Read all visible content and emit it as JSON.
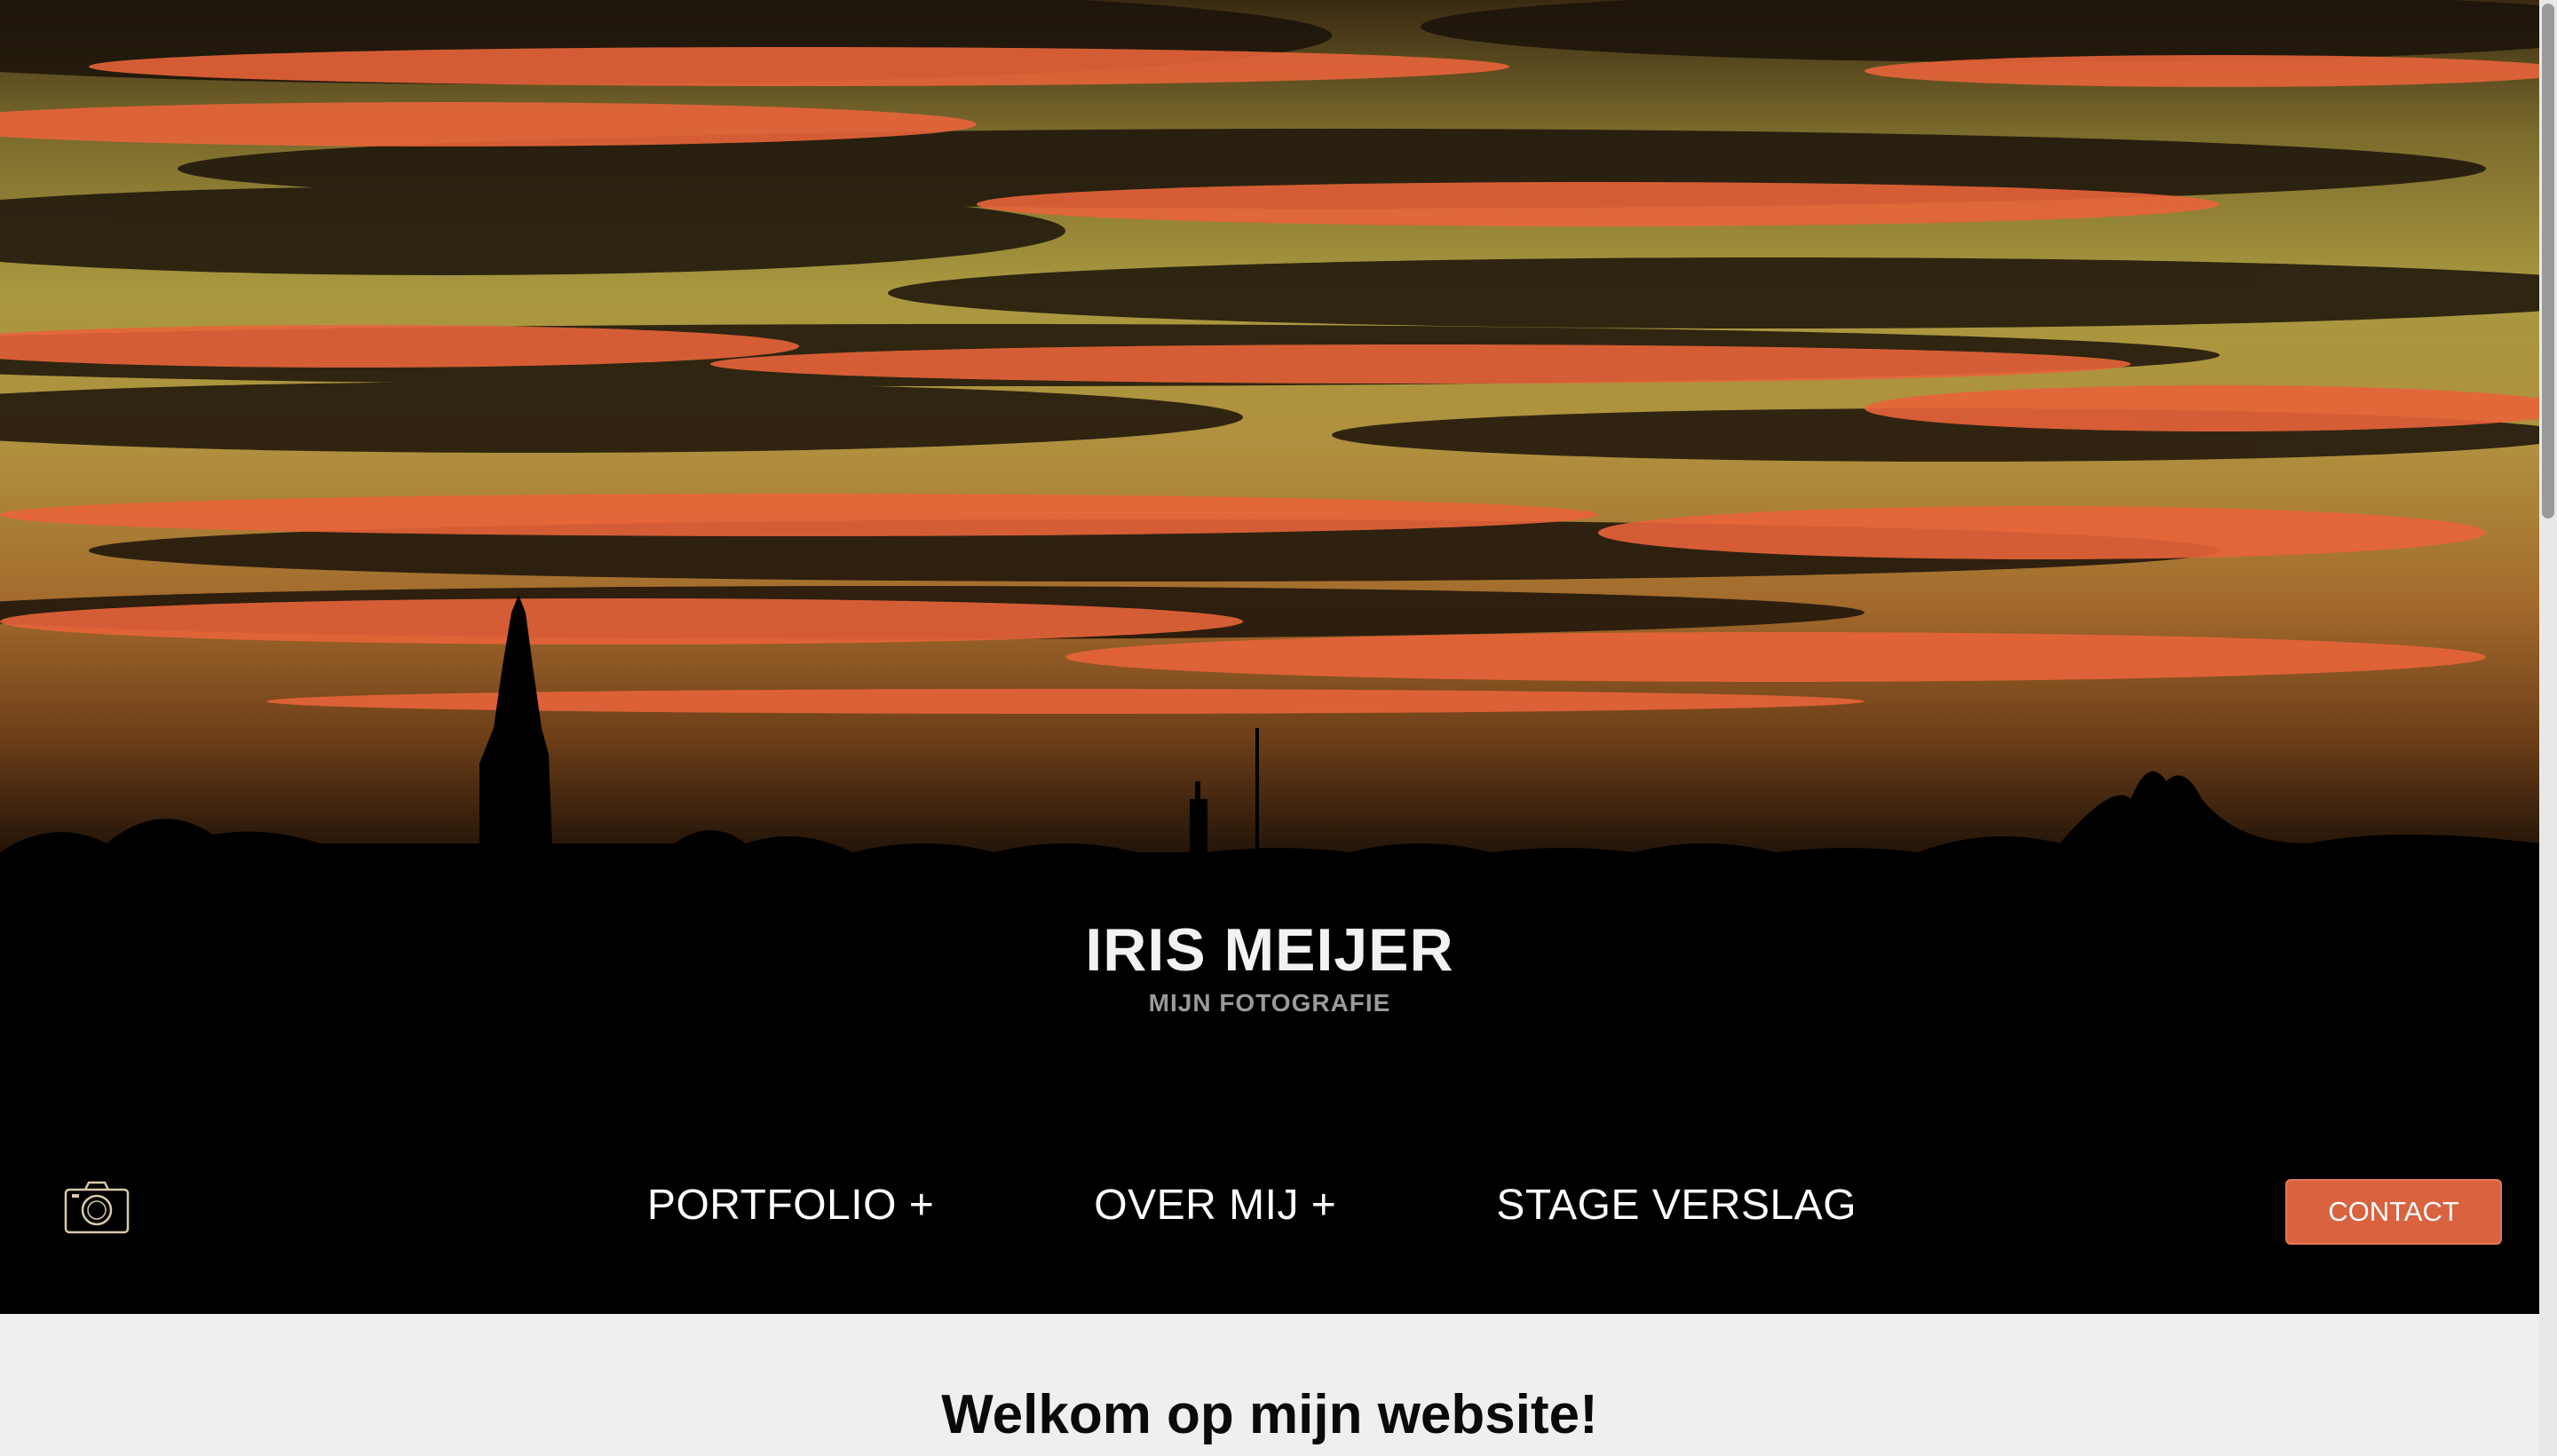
{
  "hero": {
    "title": "IRIS MEIJER",
    "subtitle": "MIJN FOTOGRAFIE",
    "image_description_icon": "sunset-church-silhouette"
  },
  "navbar": {
    "logo_icon": "camera-icon",
    "links": [
      {
        "label": "PORTFOLIO +"
      },
      {
        "label": "OVER MIJ +"
      },
      {
        "label": "STAGE VERSLAG"
      }
    ],
    "contact_label": "CONTACT"
  },
  "main": {
    "heading": "Welkom op mijn website!"
  },
  "colors": {
    "accent": "#d9623f",
    "background_light": "#efefef",
    "nav_text": "#ffffff"
  }
}
